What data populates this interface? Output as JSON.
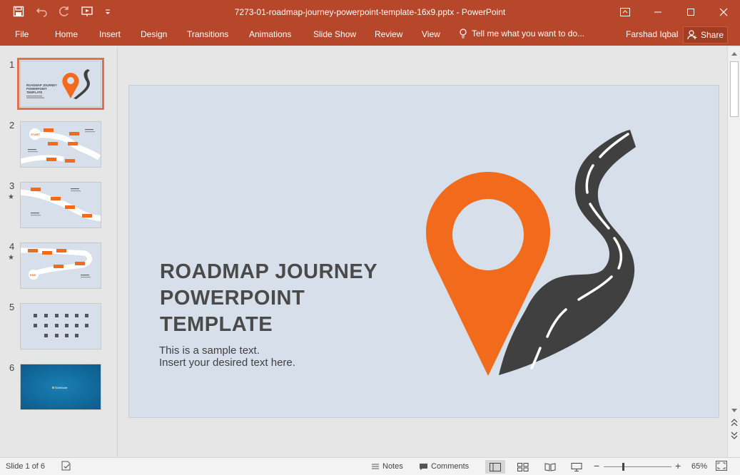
{
  "window": {
    "title": "7273-01-roadmap-journey-powerpoint-template-16x9.pptx - PowerPoint",
    "accent_color": "#b7472a"
  },
  "quick_access": {
    "icons": [
      "save-icon",
      "undo-icon",
      "redo-icon",
      "slideshow-from-start-icon",
      "customize-qat-icon"
    ]
  },
  "ribbon": {
    "tabs": [
      "File",
      "Home",
      "Insert",
      "Design",
      "Transitions",
      "Animations",
      "Slide Show",
      "Review",
      "View"
    ],
    "tell_me": "Tell me what you want to do...",
    "user": "Farshad Iqbal",
    "share": "Share"
  },
  "thumbnails": {
    "selected": 1,
    "items": [
      {
        "number": "1",
        "star": ""
      },
      {
        "number": "2",
        "star": ""
      },
      {
        "number": "3",
        "star": "★"
      },
      {
        "number": "4",
        "star": "★"
      },
      {
        "number": "5",
        "star": ""
      },
      {
        "number": "6",
        "star": ""
      }
    ],
    "slide1_title": "ROADMAP JOURNEY POWERPOINT TEMPLATE",
    "slide2_start": "START",
    "slide4_end": "END",
    "slide6_logo": "SlideModel"
  },
  "slide": {
    "title_lines": [
      "ROADMAP JOURNEY",
      "POWERPOINT",
      "TEMPLATE"
    ],
    "subtitle_lines": [
      "This is a sample text.",
      "Insert your desired text here."
    ],
    "pin_color": "#f26a1b",
    "road_color": "#404040",
    "background_color": "#d6dfea"
  },
  "status": {
    "slide_info": "Slide 1 of 6",
    "notes": "Notes",
    "comments": "Comments",
    "zoom_level": "65%",
    "zoom_minus": "−",
    "zoom_plus": "+"
  }
}
